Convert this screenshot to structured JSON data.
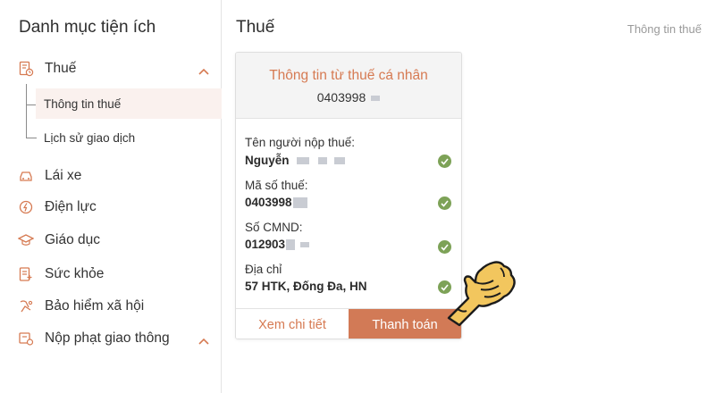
{
  "sidebar": {
    "title": "Danh mục tiện ích",
    "items": [
      {
        "label": "Thuế",
        "icon": "tax-document-icon"
      },
      {
        "label": "Lái xe",
        "icon": "car-icon"
      },
      {
        "label": "Điện lực",
        "icon": "electricity-icon"
      },
      {
        "label": "Giáo dục",
        "icon": "graduation-cap-icon"
      },
      {
        "label": "Sức khỏe",
        "icon": "health-record-icon"
      },
      {
        "label": "Bảo hiểm xã hội",
        "icon": "insurance-icon"
      },
      {
        "label": "Nộp phạt giao thông",
        "icon": "traffic-ticket-icon"
      }
    ],
    "tax_subitems": [
      {
        "label": "Thông tin thuế",
        "active": true
      },
      {
        "label": "Lịch sử giao dịch",
        "active": false
      }
    ]
  },
  "header": {
    "title": "Thuế",
    "breadcrumb": "Thông tin thuế"
  },
  "card": {
    "title": "Thông tin từ thuế cá nhân",
    "subtitle": "0403998",
    "fields": [
      {
        "label": "Tên người nộp thuế:",
        "value": "Nguyễn"
      },
      {
        "label": "Mã số thuế:",
        "value": "0403998"
      },
      {
        "label": "Số CMND:",
        "value": "012903"
      },
      {
        "label": "Địa chỉ",
        "value": "57 HTK, Đống Đa, HN"
      }
    ],
    "detail_label": "Xem chi tiết",
    "pay_label": "Thanh toán"
  },
  "colors": {
    "accent": "#d67a52",
    "pay_button": "#d27a56",
    "check": "#7da257",
    "active_bg": "#faf1ee"
  }
}
